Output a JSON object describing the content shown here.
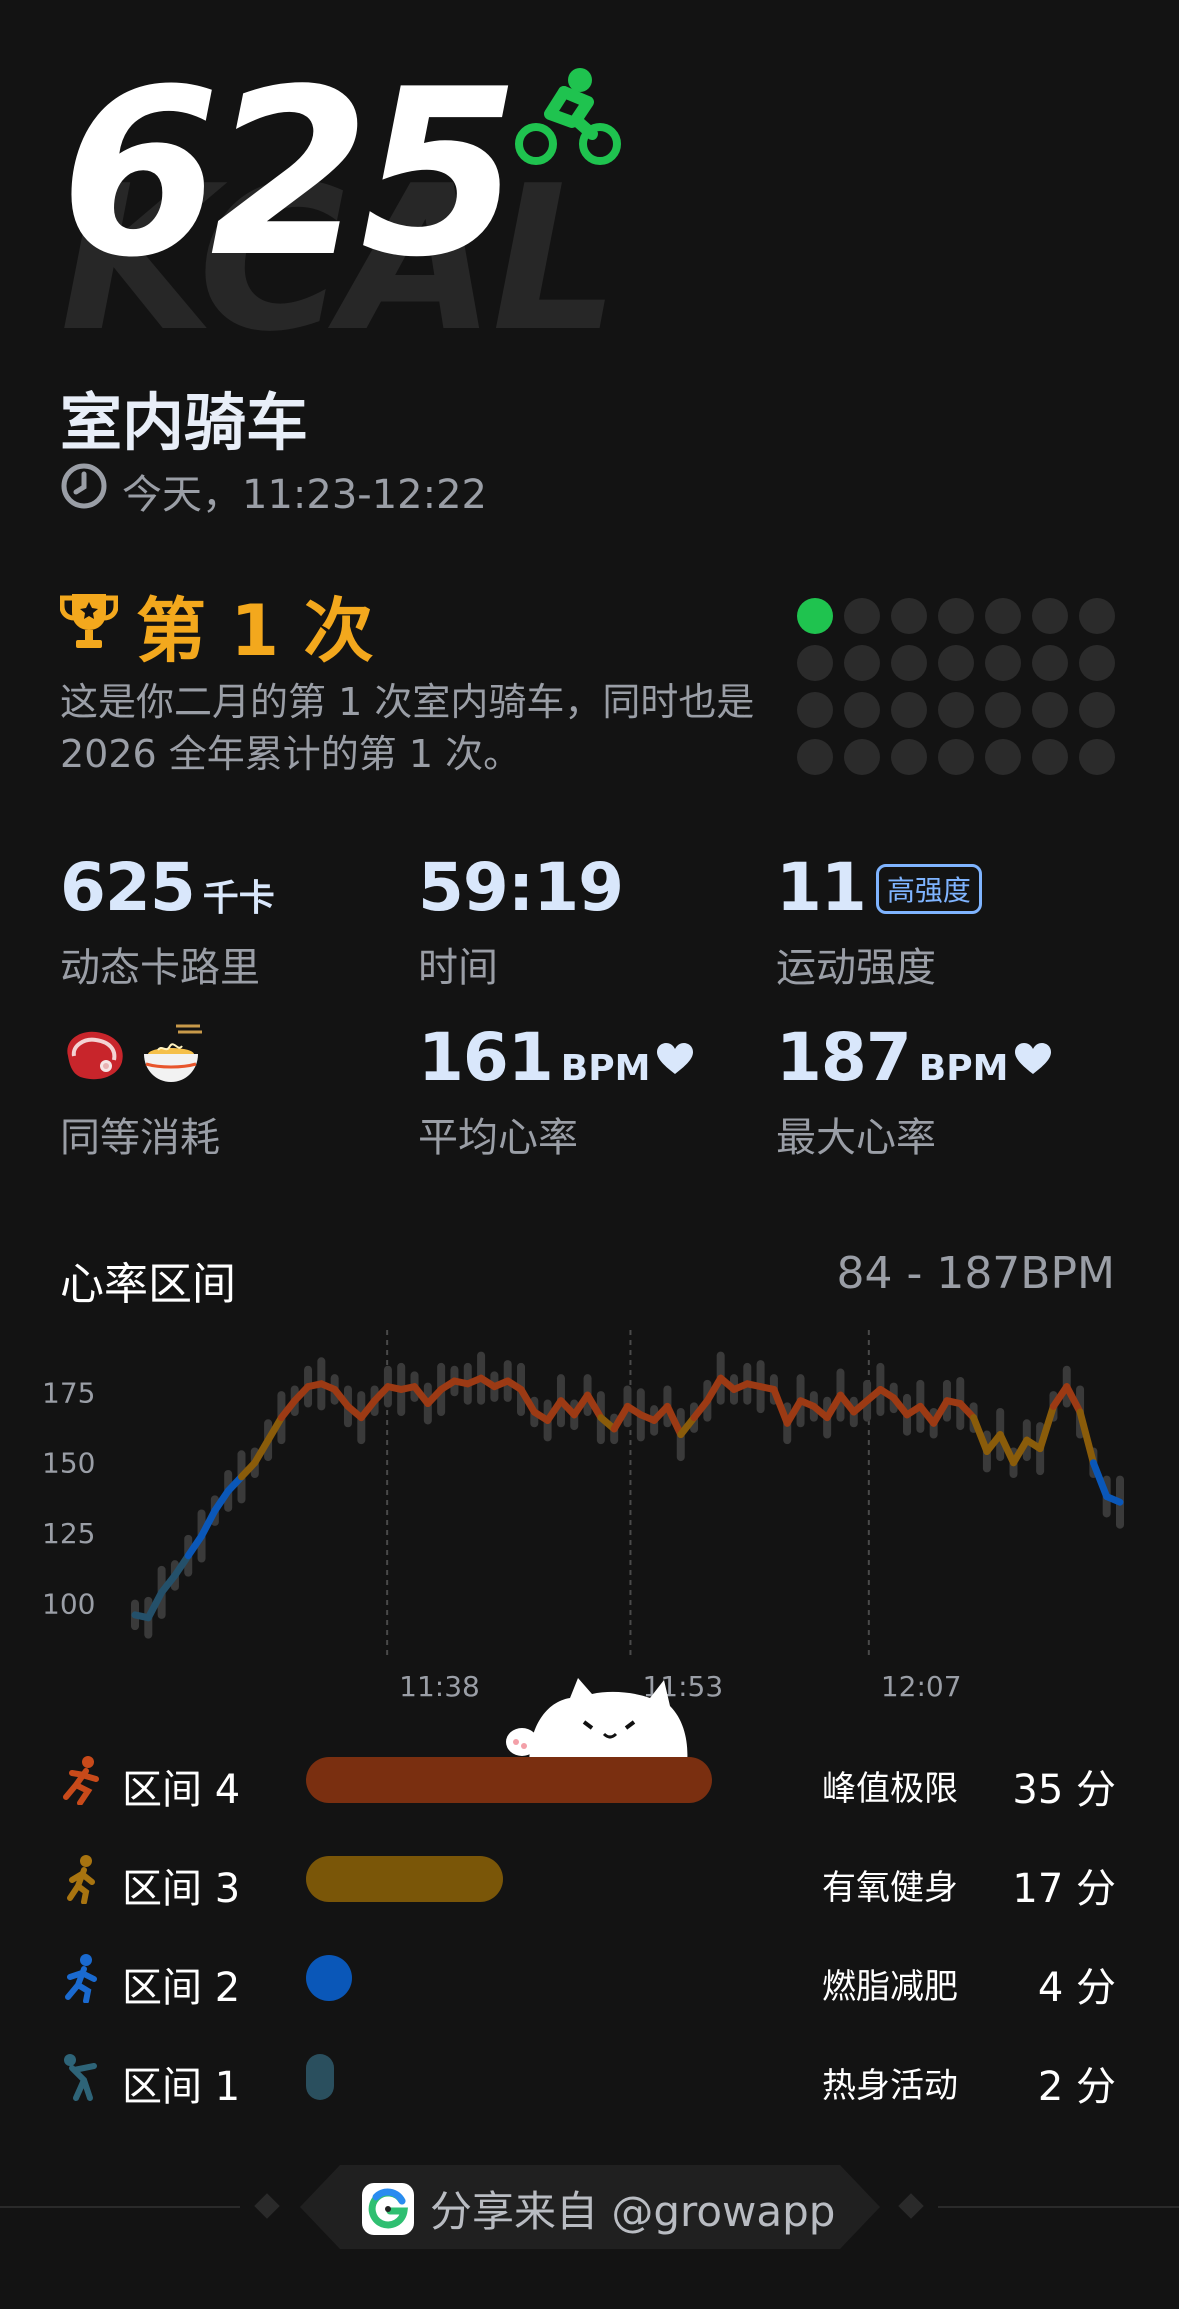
{
  "hero": {
    "value": "625",
    "unit_bg": "KCAL"
  },
  "activity": {
    "title": "室内骑车",
    "time": "今天，11:23-12:22"
  },
  "rank": {
    "label": "第 1 次",
    "description": "这是你二月的第 1 次室内骑车，同时也是 2026 全年累计的第 1 次。",
    "filled_dots": 1,
    "total_dots": 28
  },
  "stats": {
    "calories": {
      "value": "625",
      "unit": "千卡",
      "label": "动态卡路里"
    },
    "duration": {
      "value": "59:19",
      "label": "时间"
    },
    "intensity": {
      "value": "11",
      "badge": "高强度",
      "label": "运动强度"
    },
    "equivalent": {
      "label": "同等消耗"
    },
    "avg_hr": {
      "value": "161",
      "unit": "BPM",
      "label": "平均心率"
    },
    "max_hr": {
      "value": "187",
      "unit": "BPM",
      "label": "最大心率"
    }
  },
  "heart_rate": {
    "title": "心率区间",
    "range": "84 - 187BPM"
  },
  "chart_data": {
    "type": "line",
    "y_ticks": [
      "175",
      "150",
      "125",
      "100"
    ],
    "x_ticks": [
      "11:38",
      "11:53",
      "12:07"
    ],
    "ylim": [
      80,
      190
    ],
    "y": [
      96,
      95,
      104,
      110,
      117,
      124,
      133,
      140,
      145,
      150,
      158,
      166,
      172,
      177,
      178,
      176,
      170,
      166,
      172,
      177,
      176,
      177,
      171,
      176,
      179,
      178,
      180,
      177,
      179,
      176,
      168,
      165,
      172,
      167,
      174,
      166,
      162,
      170,
      167,
      165,
      170,
      160,
      166,
      172,
      180,
      176,
      178,
      177,
      176,
      164,
      172,
      170,
      166,
      174,
      168,
      172,
      176,
      173,
      167,
      170,
      164,
      172,
      171,
      166,
      154,
      160,
      150,
      158,
      155,
      170,
      177,
      168,
      150,
      138,
      136
    ],
    "zone_colors": {
      "zone4": "#9c3a14",
      "zone3": "#8a5c0a",
      "zone2": "#0a57b8",
      "zone1": "#24506a"
    }
  },
  "zones": [
    {
      "label": "区间 4",
      "name": "峰值极限",
      "minutes": "35 分",
      "fraction": 1.0,
      "color": "#7a2f10"
    },
    {
      "label": "区间 3",
      "name": "有氧健身",
      "minutes": "17 分",
      "fraction": 0.486,
      "color": "#7a5608"
    },
    {
      "label": "区间 2",
      "name": "燃脂减肥",
      "minutes": "4 分",
      "fraction": 0.114,
      "color": "#0a57b8"
    },
    {
      "label": "区间 1",
      "name": "热身活动",
      "minutes": "2 分",
      "fraction": 0.057,
      "color": "#2a4f5e"
    }
  ],
  "footer": {
    "text": "分享来自 @growapp"
  },
  "colors": {
    "accent_green": "#1fc34f",
    "trophy": "#f3a81d",
    "stat_text": "#d9e7fb",
    "muted": "#9a9ea6"
  }
}
